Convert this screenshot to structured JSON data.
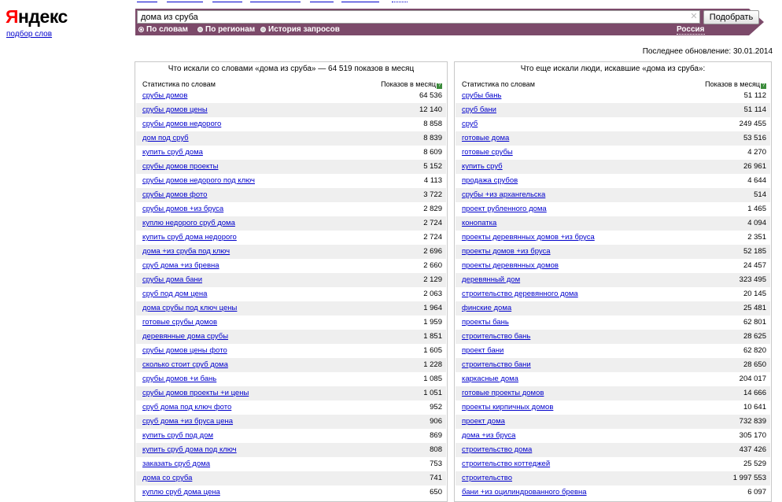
{
  "brand": {
    "logo_first": "Я",
    "logo_rest": "ндекс",
    "sublink": "подбор слов"
  },
  "search": {
    "query": "дома из сруба",
    "submit_label": "Подобрать",
    "region": "Россия"
  },
  "radios": [
    {
      "label": "По словам",
      "selected": true
    },
    {
      "label": "По регионам",
      "selected": false
    },
    {
      "label": "История запросов",
      "selected": false
    }
  ],
  "updated": "Последнее обновление: 30.01.2014",
  "left_panel": {
    "title": "Что искали со словами «дома из сруба» — 64 519 показов в месяц",
    "col1": "Статистика по словам",
    "col2": "Показов в месяц",
    "rows": [
      {
        "kw": "срубы домов",
        "cnt": "64 536"
      },
      {
        "kw": "срубы домов цены",
        "cnt": "12 140"
      },
      {
        "kw": "срубы домов недорого",
        "cnt": "8 858"
      },
      {
        "kw": "дом под сруб",
        "cnt": "8 839"
      },
      {
        "kw": "купить сруб дома",
        "cnt": "8 609"
      },
      {
        "kw": "срубы домов проекты",
        "cnt": "5 152"
      },
      {
        "kw": "срубы домов недорого под ключ",
        "cnt": "4 113"
      },
      {
        "kw": "срубы домов фото",
        "cnt": "3 722"
      },
      {
        "kw": "срубы домов +из бруса",
        "cnt": "2 829"
      },
      {
        "kw": "куплю недорого сруб дома",
        "cnt": "2 724"
      },
      {
        "kw": "купить сруб дома недорого",
        "cnt": "2 724"
      },
      {
        "kw": "дома +из сруба под ключ",
        "cnt": "2 696"
      },
      {
        "kw": "сруб дома +из бревна",
        "cnt": "2 660"
      },
      {
        "kw": "срубы дома бани",
        "cnt": "2 129"
      },
      {
        "kw": "сруб под дом цена",
        "cnt": "2 063"
      },
      {
        "kw": "дома срубы под ключ цены",
        "cnt": "1 964"
      },
      {
        "kw": "готовые срубы домов",
        "cnt": "1 959"
      },
      {
        "kw": "деревянные дома срубы",
        "cnt": "1 851"
      },
      {
        "kw": "срубы домов цены фото",
        "cnt": "1 605"
      },
      {
        "kw": "сколько стоит сруб дома",
        "cnt": "1 228"
      },
      {
        "kw": "срубы домов +и бань",
        "cnt": "1 085"
      },
      {
        "kw": "срубы домов проекты +и цены",
        "cnt": "1 051"
      },
      {
        "kw": "сруб дома под ключ фото",
        "cnt": "952"
      },
      {
        "kw": "сруб дома +из бруса цена",
        "cnt": "906"
      },
      {
        "kw": "купить сруб под дом",
        "cnt": "869"
      },
      {
        "kw": "купить сруб дома под ключ",
        "cnt": "808"
      },
      {
        "kw": "заказать сруб дома",
        "cnt": "753"
      },
      {
        "kw": "дома со сруба",
        "cnt": "741"
      },
      {
        "kw": "куплю сруб дома цена",
        "cnt": "650"
      }
    ]
  },
  "right_panel": {
    "title": "Что еще искали люди, искавшие «дома из сруба»:",
    "col1": "Статистика по словам",
    "col2": "Показов в месяц",
    "rows": [
      {
        "kw": "срубы бань",
        "cnt": "51 112"
      },
      {
        "kw": "сруб бани",
        "cnt": "51 114"
      },
      {
        "kw": "сруб",
        "cnt": "249 455"
      },
      {
        "kw": "готовые дома",
        "cnt": "53 516"
      },
      {
        "kw": "готовые срубы",
        "cnt": "4 270"
      },
      {
        "kw": "купить сруб",
        "cnt": "26 961"
      },
      {
        "kw": "продажа срубов",
        "cnt": "4 644"
      },
      {
        "kw": "срубы +из архангельска",
        "cnt": "514"
      },
      {
        "kw": "проект рубленного дома",
        "cnt": "1 465"
      },
      {
        "kw": "конопатка",
        "cnt": "4 094"
      },
      {
        "kw": "проекты деревянных домов +из бруса",
        "cnt": "2 351"
      },
      {
        "kw": "проекты домов +из бруса",
        "cnt": "52 185"
      },
      {
        "kw": "проекты деревянных домов",
        "cnt": "24 457"
      },
      {
        "kw": "деревянный дом",
        "cnt": "323 495"
      },
      {
        "kw": "строительство деревянного дома",
        "cnt": "20 145"
      },
      {
        "kw": "финские дома",
        "cnt": "25 481"
      },
      {
        "kw": "проекты бань",
        "cnt": "62 801"
      },
      {
        "kw": "строительство бань",
        "cnt": "28 625"
      },
      {
        "kw": "проект бани",
        "cnt": "62 820"
      },
      {
        "kw": "строительство бани",
        "cnt": "28 650"
      },
      {
        "kw": "каркасные дома",
        "cnt": "204 017"
      },
      {
        "kw": "готовые проекты домов",
        "cnt": "14 666"
      },
      {
        "kw": "проекты кирпичных домов",
        "cnt": "10 641"
      },
      {
        "kw": "проект дома",
        "cnt": "732 839"
      },
      {
        "kw": "дома +из бруса",
        "cnt": "305 170"
      },
      {
        "kw": "строительство дома",
        "cnt": "437 426"
      },
      {
        "kw": "строительство коттеджей",
        "cnt": "25 529"
      },
      {
        "kw": "строительство",
        "cnt": "1 997 553"
      },
      {
        "kw": "бани +из оцилиндрованного бревна",
        "cnt": "6 097"
      }
    ]
  }
}
